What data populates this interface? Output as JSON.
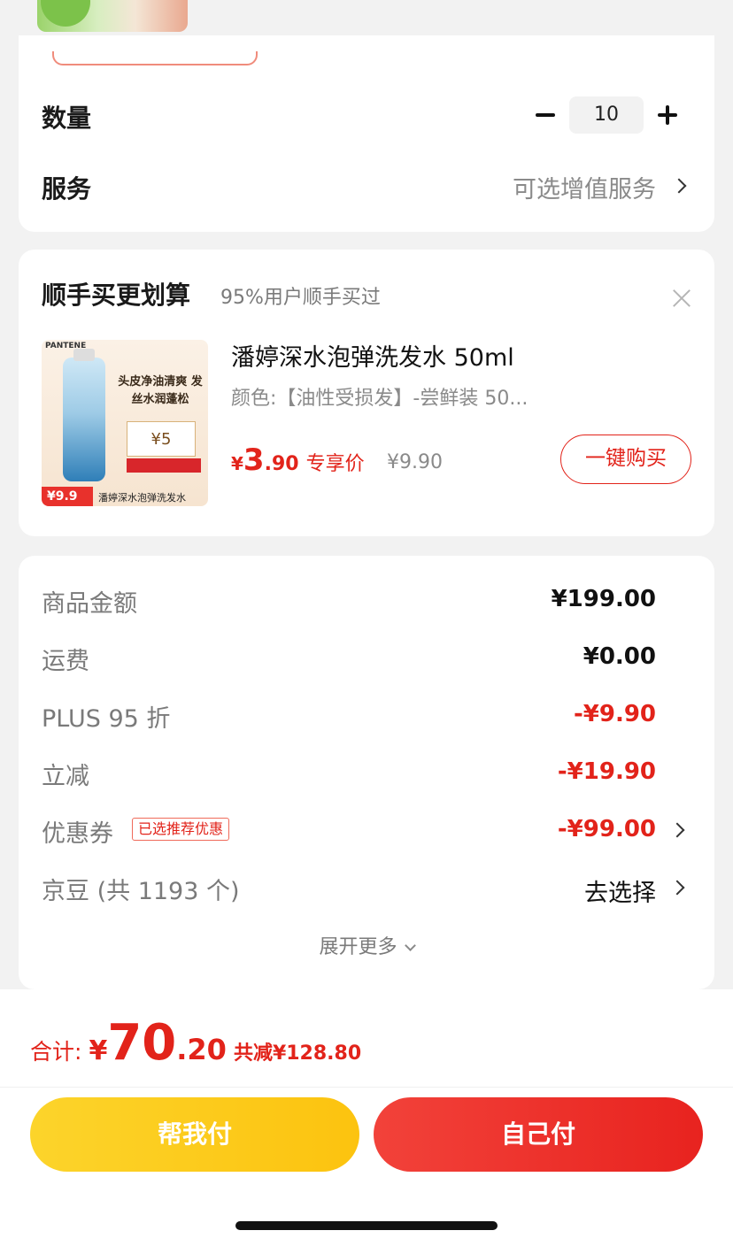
{
  "quantity": {
    "label": "数量",
    "value": "10"
  },
  "service": {
    "label": "服务",
    "value": "可选增值服务"
  },
  "addon": {
    "title": "顺手买更划算",
    "subtitle": "95%用户顺手买过",
    "product": {
      "image_brand": "PANTENE",
      "image_headline": "头皮净油清爽 发丝水润蓬松",
      "image_coupon": "¥5",
      "image_price_tag": "¥9.9",
      "image_caption": "潘婷深水泡弹洗发水",
      "name": "潘婷深水泡弹洗发水 50ml",
      "spec": "颜色:【油性受损发】-尝鲜装 50...",
      "price_currency": "¥",
      "price_int": "3",
      "price_dec": ".90",
      "price_tag": "专享价",
      "original_price": "¥9.90",
      "buy_label": "一键购买"
    }
  },
  "summary": {
    "rows": [
      {
        "label": "商品金额",
        "value": "¥199.00"
      },
      {
        "label": "运费",
        "value": "¥0.00"
      },
      {
        "label": "PLUS 95 折",
        "value": "-¥9.90"
      },
      {
        "label": "立减",
        "value": "-¥19.90"
      },
      {
        "label": "优惠券",
        "badge": "已选推荐优惠",
        "value": "-¥99.00"
      },
      {
        "label": "京豆 (共 1193 个)",
        "value": "去选择"
      }
    ],
    "expand_label": "展开更多"
  },
  "footer": {
    "total_label": "合计:",
    "total_currency": "¥",
    "total_int": "70",
    "total_dec": ".20",
    "total_saving": "共减¥128.80",
    "pay_help_label": "帮我付",
    "pay_self_label": "自己付"
  },
  "colors": {
    "accent_red": "#e2231a",
    "help_yellow": "#fcc30f",
    "background": "#f2f2f2"
  }
}
